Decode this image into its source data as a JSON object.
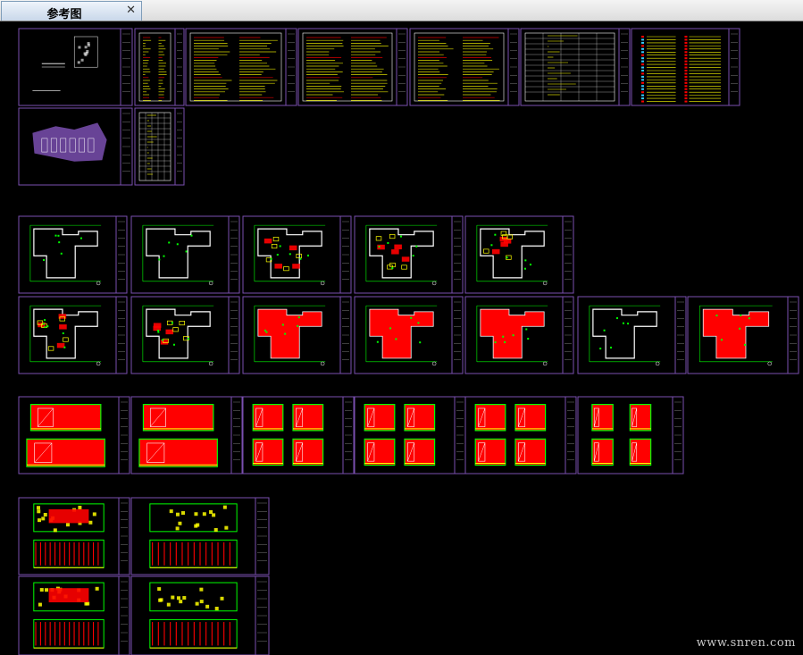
{
  "tab": {
    "label": "参考图",
    "close_glyph": "✕"
  },
  "tab_icons": {
    "close": "close-icon"
  },
  "watermark": "www.snren.com",
  "colors": {
    "background": "#000000",
    "frame": "#7a4fb0",
    "fill": "#ff0000",
    "line_green": "#00ff00",
    "line_yellow": "#ffff00",
    "text_white": "#ffffff"
  }
}
